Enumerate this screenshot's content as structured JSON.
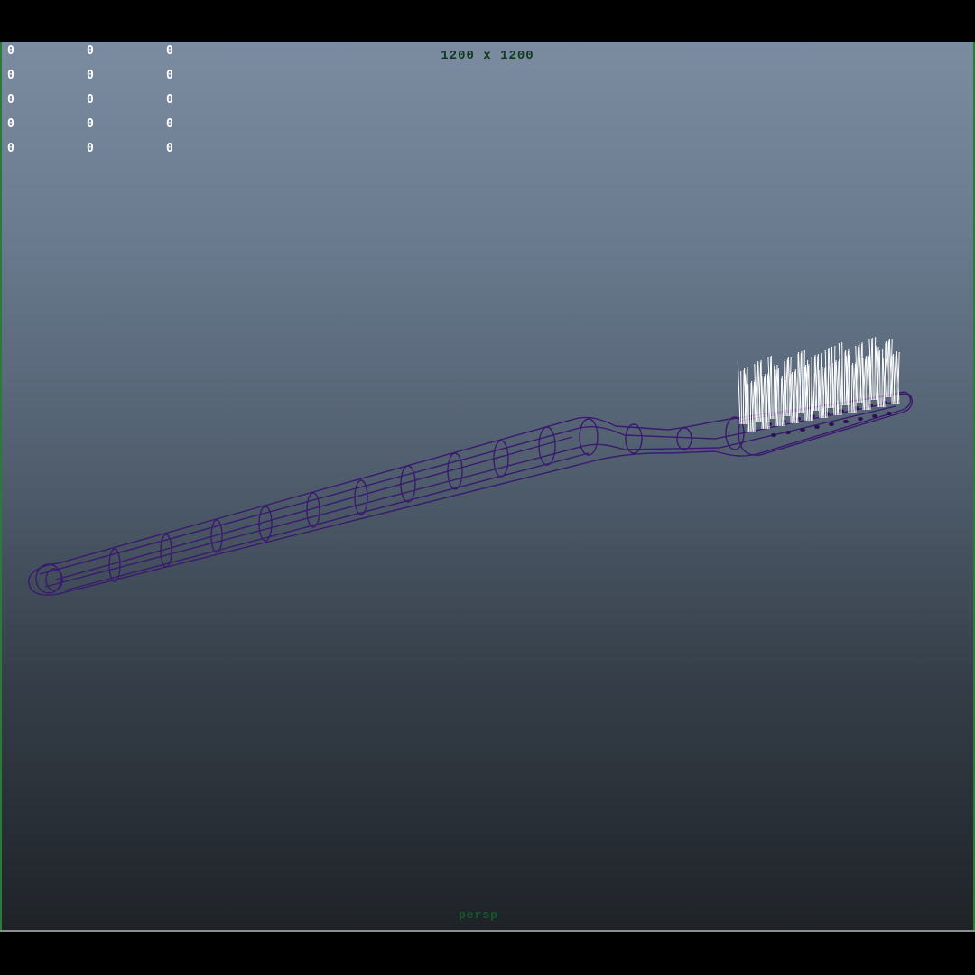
{
  "viewport": {
    "resolution_gate": "1200 x 1200",
    "camera": "persp",
    "hud_rows": [
      [
        "0",
        "0",
        "0"
      ],
      [
        "0",
        "0",
        "0"
      ],
      [
        "0",
        "0",
        "0"
      ],
      [
        "0",
        "0",
        "0"
      ],
      [
        "0",
        "0",
        "0"
      ]
    ]
  },
  "scene": {
    "object": "toothbrush-wireframe",
    "wire_color": "#3a1a6e",
    "bristle_color": "#ffffff",
    "background_top": "#7b8ba0",
    "background_bottom": "#1f2328",
    "border_color": "#2c7a3a"
  }
}
